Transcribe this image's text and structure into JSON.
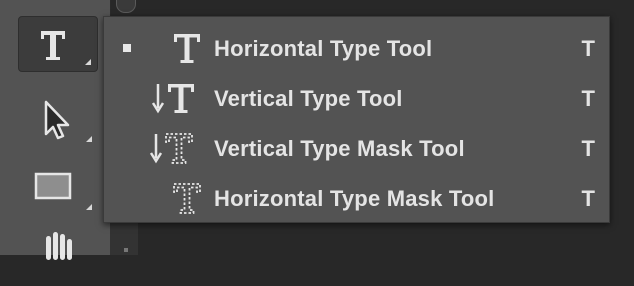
{
  "toolbar": {
    "tools": [
      {
        "name": "type-tool",
        "icon": "type-icon",
        "active": true
      },
      {
        "name": "move-tool",
        "icon": "arrow-cursor-icon",
        "active": false
      },
      {
        "name": "rectangle-tool",
        "icon": "rectangle-icon",
        "active": false
      },
      {
        "name": "hand-tool",
        "icon": "hand-icon",
        "active": false
      }
    ]
  },
  "menu": {
    "items": [
      {
        "label": "Horizontal Type Tool",
        "shortcut": "T",
        "icon": "horizontal-type-icon",
        "selected": true
      },
      {
        "label": "Vertical Type Tool",
        "shortcut": "T",
        "icon": "vertical-type-icon",
        "selected": false
      },
      {
        "label": "Vertical Type Mask Tool",
        "shortcut": "T",
        "icon": "vertical-type-mask-icon",
        "selected": false
      },
      {
        "label": "Horizontal Type Mask Tool",
        "shortcut": "T",
        "icon": "horizontal-type-mask-icon",
        "selected": false
      }
    ]
  },
  "colors": {
    "panel": "#535353",
    "background": "#282828",
    "text": "#e4e4e4"
  }
}
